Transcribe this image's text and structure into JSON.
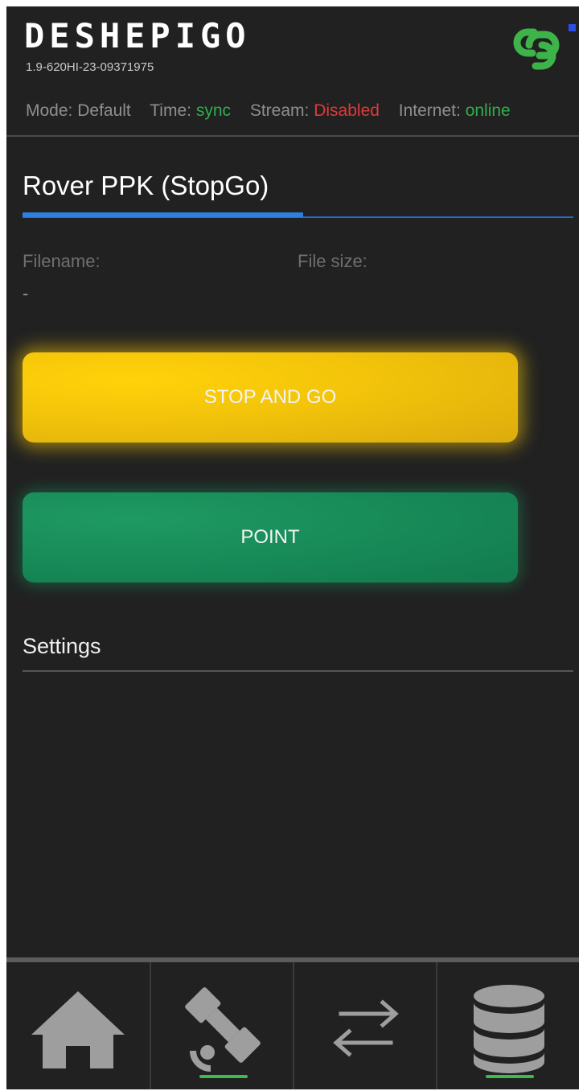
{
  "header": {
    "brand": "DESHEPIGO",
    "version": "1.9-620HI-23-09371975",
    "link_icon": "link-chain-icon",
    "status": {
      "mode_label": "Mode:",
      "mode_value": "Default",
      "time_label": "Time:",
      "time_value": "sync",
      "stream_label": "Stream:",
      "stream_value": "Disabled",
      "internet_label": "Internet:",
      "internet_value": "online"
    }
  },
  "main": {
    "title": "Rover PPK (StopGo)",
    "title_progress_percent": 51,
    "filename_label": "Filename:",
    "filename_value": "-",
    "filesize_label": "File size:",
    "filesize_value": "",
    "buttons": {
      "stop_and_go": "STOP AND GO",
      "point": "POINT"
    },
    "settings_label": "Settings"
  },
  "nav": {
    "items": [
      {
        "icon": "home-icon",
        "active": false
      },
      {
        "icon": "satellite-icon",
        "active": true
      },
      {
        "icon": "transfer-arrows-icon",
        "active": false
      },
      {
        "icon": "database-icon",
        "active": true
      }
    ]
  },
  "colors": {
    "background": "#212121",
    "ok_green": "#2fae4a",
    "error_red": "#df3a3a",
    "accent_blue": "#2f7fe0",
    "stop_yellow": "#f2c30a",
    "point_green": "#178a58",
    "nav_indicator": "#3fb950"
  }
}
